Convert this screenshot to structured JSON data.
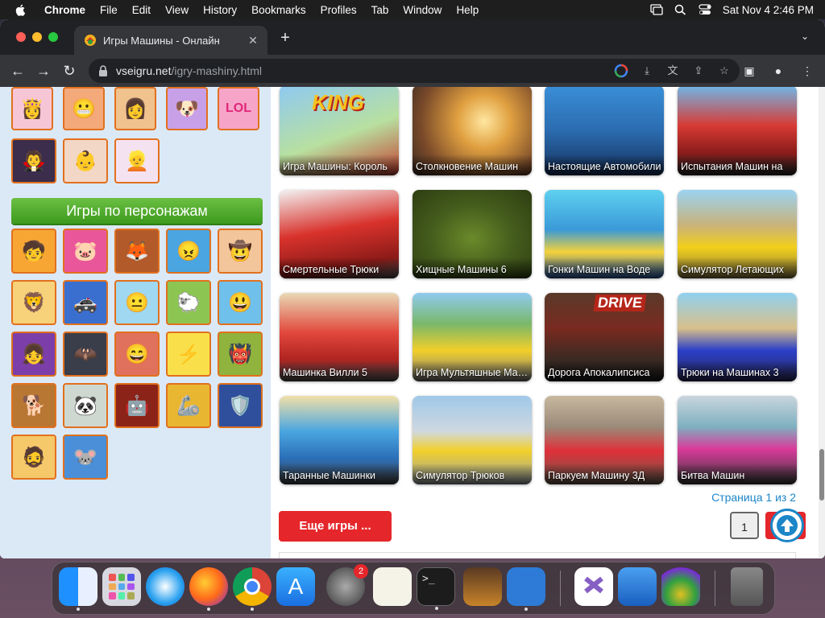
{
  "menubar": {
    "app": "Chrome",
    "items": [
      "File",
      "Edit",
      "View",
      "History",
      "Bookmarks",
      "Profiles",
      "Tab",
      "Window",
      "Help"
    ],
    "datetime": "Sat Nov 4  2:46 PM"
  },
  "browser": {
    "tab_title": "Игры Машины - Онлайн",
    "url_host": "vseigru.net",
    "url_path": "/igry-mashiny.html"
  },
  "sidebar": {
    "category_title": "Игры по персонажам"
  },
  "games": [
    {
      "title": "Игра Машины: Король"
    },
    {
      "title": "Столкновение Машин"
    },
    {
      "title": "Настоящие Автомобили"
    },
    {
      "title": "Испытания Машин на"
    },
    {
      "title": "Смертельные Трюки"
    },
    {
      "title": "Хищные Машины 6"
    },
    {
      "title": "Гонки Машин на Воде"
    },
    {
      "title": "Симулятор Летающих"
    },
    {
      "title": "Машинка Вилли 5"
    },
    {
      "title": "Игра Мультяшные Машинки"
    },
    {
      "title": "Дорога Апокалипсиса"
    },
    {
      "title": "Трюки на Машинах 3"
    },
    {
      "title": "Таранные Машинки"
    },
    {
      "title": "Симулятор Трюков"
    },
    {
      "title": "Паркуем Машину 3Д"
    },
    {
      "title": "Битва Машин"
    }
  ],
  "game_art_labels": {
    "king": "KING",
    "drive": "DRIVE"
  },
  "pagination": {
    "summary": "Страница 1 из 2",
    "current_page": "1",
    "more_label": "Еще игры ..."
  },
  "dock": {
    "settings_badge": "2"
  }
}
